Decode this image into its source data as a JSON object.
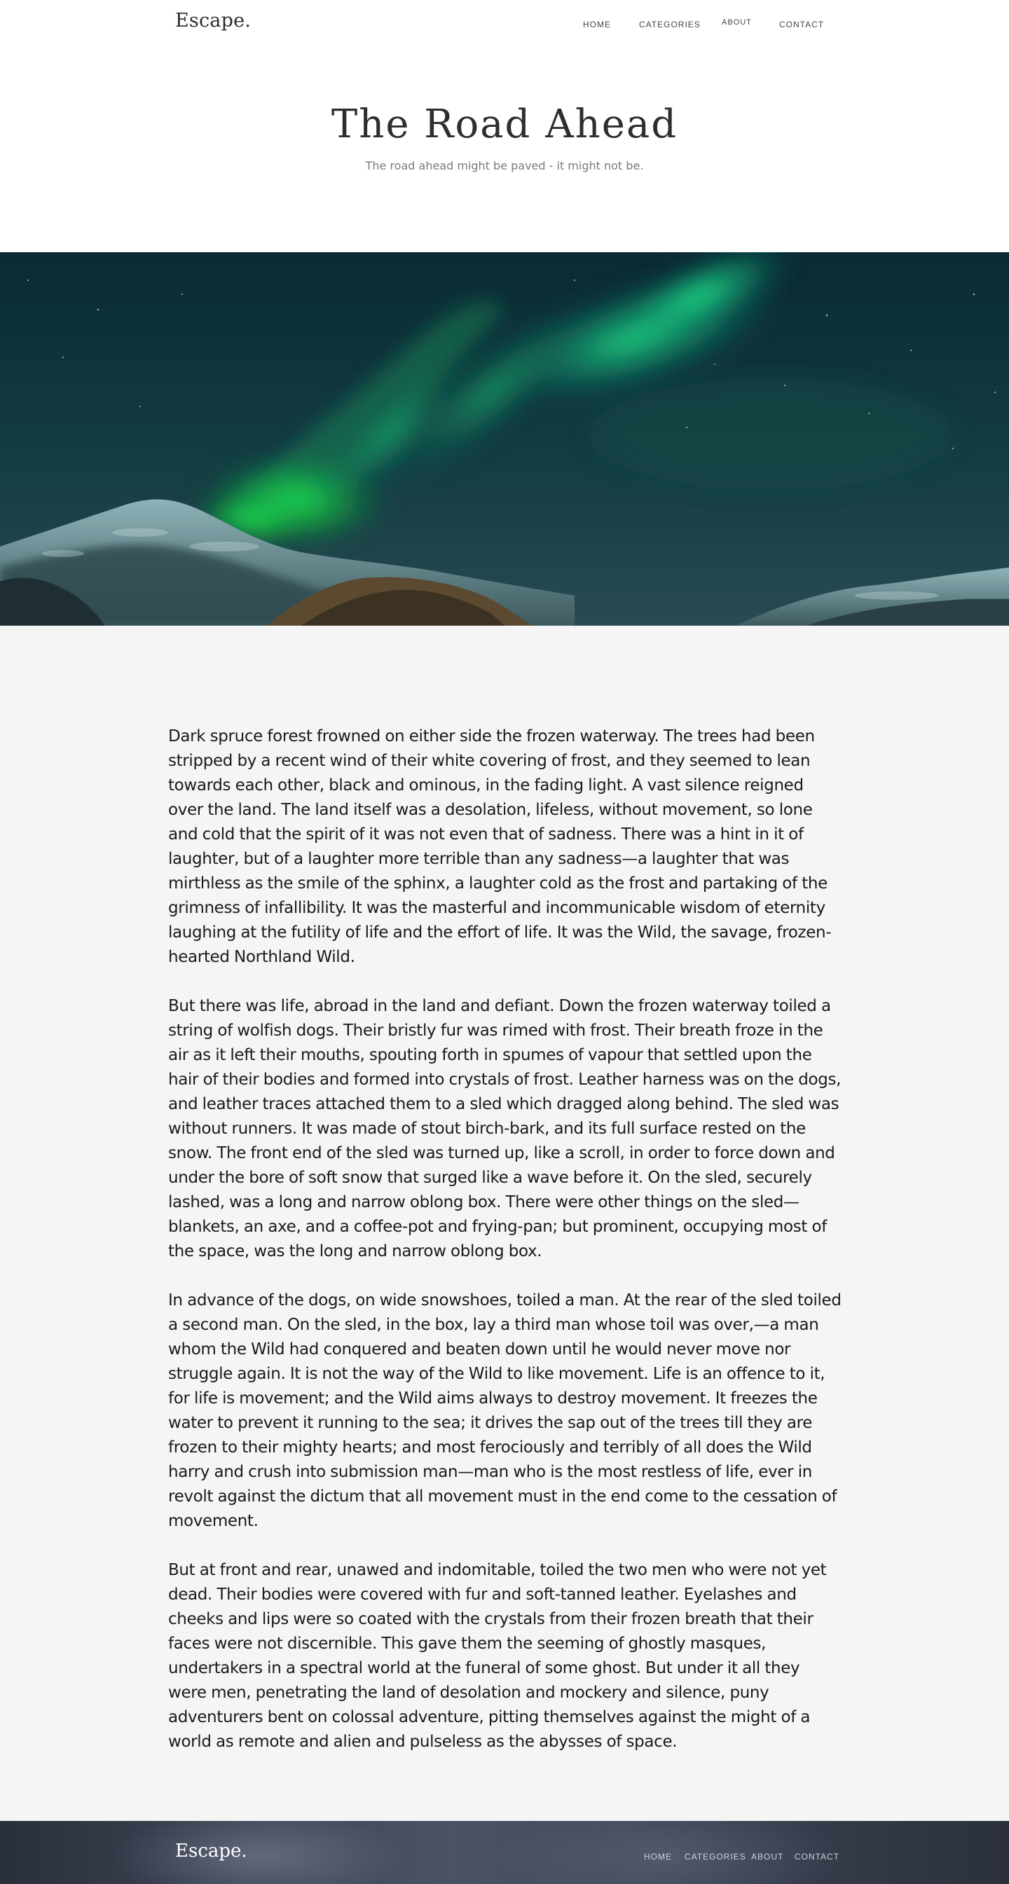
{
  "header": {
    "brand": "Escape.",
    "nav": [
      {
        "label": "HOME"
      },
      {
        "label": "CATEGORIES"
      },
      {
        "label": "ABOUT"
      },
      {
        "label": "CONTACT"
      }
    ]
  },
  "hero": {
    "title": "The Road Ahead",
    "subtitle": "The road ahead might be paved - it might not be."
  },
  "article": {
    "paragraphs": [
      "Dark spruce forest frowned on either side the frozen waterway. The trees had been stripped by a recent wind of their white covering of frost, and they seemed to lean towards each other, black and ominous, in the fading light. A vast silence reigned over the land. The land itself was a desolation, lifeless, without movement, so lone and cold that the spirit of it was not even that of sadness. There was a hint in it of laughter, but of a laughter more terrible than any sadness—a laughter that was mirthless as the smile of the sphinx, a laughter cold as the frost and partaking of the grimness of infallibility. It was the masterful and incommunicable wisdom of eternity laughing at the futility of life and the effort of life. It was the Wild, the savage, frozen-hearted Northland Wild.",
      "But there was life, abroad in the land and defiant. Down the frozen waterway toiled a string of wolfish dogs. Their bristly fur was rimed with frost. Their breath froze in the air as it left their mouths, spouting forth in spumes of vapour that settled upon the hair of their bodies and formed into crystals of frost. Leather harness was on the dogs, and leather traces attached them to a sled which dragged along behind. The sled was without runners. It was made of stout birch-bark, and its full surface rested on the snow. The front end of the sled was turned up, like a scroll, in order to force down and under the bore of soft snow that surged like a wave before it. On the sled, securely lashed, was a long and narrow oblong box. There were other things on the sled—blankets, an axe, and a coffee-pot and frying-pan; but prominent, occupying most of the space, was the long and narrow oblong box.",
      "In advance of the dogs, on wide snowshoes, toiled a man. At the rear of the sled toiled a second man. On the sled, in the box, lay a third man whose toil was over,—a man whom the Wild had conquered and beaten down until he would never move nor struggle again. It is not the way of the Wild to like movement. Life is an offence to it, for life is movement; and the Wild aims always to destroy movement. It freezes the water to prevent it running to the sea; it drives the sap out of the trees till they are frozen to their mighty hearts; and most ferociously and terribly of all does the Wild harry and crush into submission man—man who is the most restless of life, ever in revolt against the dictum that all movement must in the end come to the cessation of movement.",
      "But at front and rear, unawed and indomitable, toiled the two men who were not yet dead. Their bodies were covered with fur and soft-tanned leather. Eyelashes and cheeks and lips were so coated with the crystals from their frozen breath that their faces were not discernible. This gave them the seeming of ghostly masques, undertakers in a spectral world at the funeral of some ghost. But under it all they were men, penetrating the land of desolation and mockery and silence, puny adventurers bent on colossal adventure, pitting themselves against the might of a world as remote and alien and pulseless as the abysses of space."
    ]
  },
  "footer": {
    "brand": "Escape.",
    "nav": [
      {
        "label": "HOME"
      },
      {
        "label": "CATEGORIES"
      },
      {
        "label": "ABOUT"
      },
      {
        "label": "CONTACT"
      }
    ]
  },
  "colors": {
    "aurora_green": "#1fe06a",
    "sky": "#0e2b35",
    "background": "#f5f5f5"
  }
}
